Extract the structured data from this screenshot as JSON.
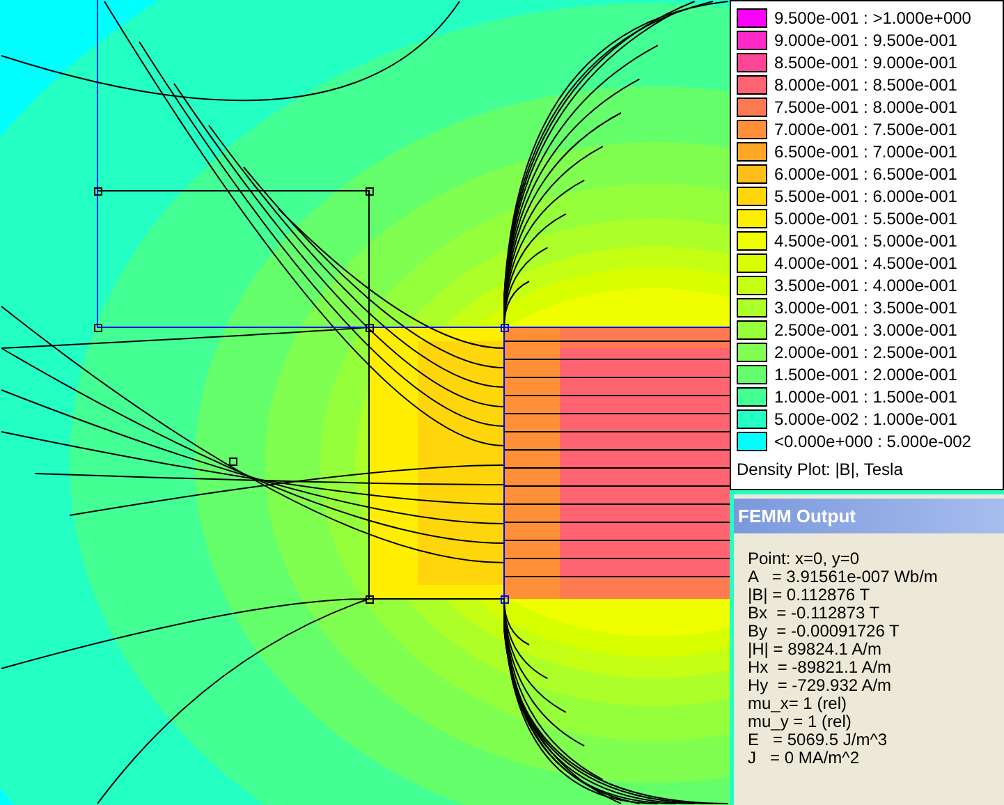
{
  "legend": {
    "items": [
      {
        "label": "9.500e-001 : >1.000e+000",
        "color": "#ff00ff"
      },
      {
        "label": "9.000e-001 : 9.500e-001",
        "color": "#ff28c8"
      },
      {
        "label": "8.500e-001 : 9.000e-001",
        "color": "#ff4696"
      },
      {
        "label": "8.000e-001 : 8.500e-001",
        "color": "#ff6470"
      },
      {
        "label": "7.500e-001 : 8.000e-001",
        "color": "#ff7a50"
      },
      {
        "label": "7.000e-001 : 7.500e-001",
        "color": "#ff9038"
      },
      {
        "label": "6.500e-001 : 7.000e-001",
        "color": "#ffa828"
      },
      {
        "label": "6.000e-001 : 6.500e-001",
        "color": "#ffbe18"
      },
      {
        "label": "5.500e-001 : 6.000e-001",
        "color": "#ffd60c"
      },
      {
        "label": "5.000e-001 : 5.500e-001",
        "color": "#ffee00"
      },
      {
        "label": "4.500e-001 : 5.000e-001",
        "color": "#f0ff00"
      },
      {
        "label": "4.000e-001 : 4.500e-001",
        "color": "#d8ff00"
      },
      {
        "label": "3.500e-001 : 4.000e-001",
        "color": "#c4ff14"
      },
      {
        "label": "3.000e-001 : 3.500e-001",
        "color": "#acff28"
      },
      {
        "label": "2.500e-001 : 3.000e-001",
        "color": "#96ff3c"
      },
      {
        "label": "2.000e-001 : 2.500e-001",
        "color": "#80ff50"
      },
      {
        "label": "1.500e-001 : 2.000e-001",
        "color": "#64ff6a"
      },
      {
        "label": "1.000e-001 : 1.500e-001",
        "color": "#44ff94"
      },
      {
        "label": "5.000e-002 : 1.000e-001",
        "color": "#24ffc4"
      },
      {
        "label": "<0.000e+000 : 5.000e-002",
        "color": "#00ffff"
      }
    ],
    "caption": "Density Plot: |B|, Tesla"
  },
  "output": {
    "title": "FEMM Output",
    "lines": [
      "Point: x=0, y=0",
      "A   = 3.91561e-007 Wb/m",
      "|B| = 0.112876 T",
      "Bx  = -0.112873 T",
      "By  = -0.00091726 T",
      "|H| = 89824.1 A/m",
      "Hx  = -89821.1 A/m",
      "Hy  = -729.932 A/m",
      "mu_x= 1 (rel)",
      "mu_y = 1 (rel)",
      "E   = 5069.5 J/m^3",
      "J   = 0 MA/m^2"
    ]
  }
}
